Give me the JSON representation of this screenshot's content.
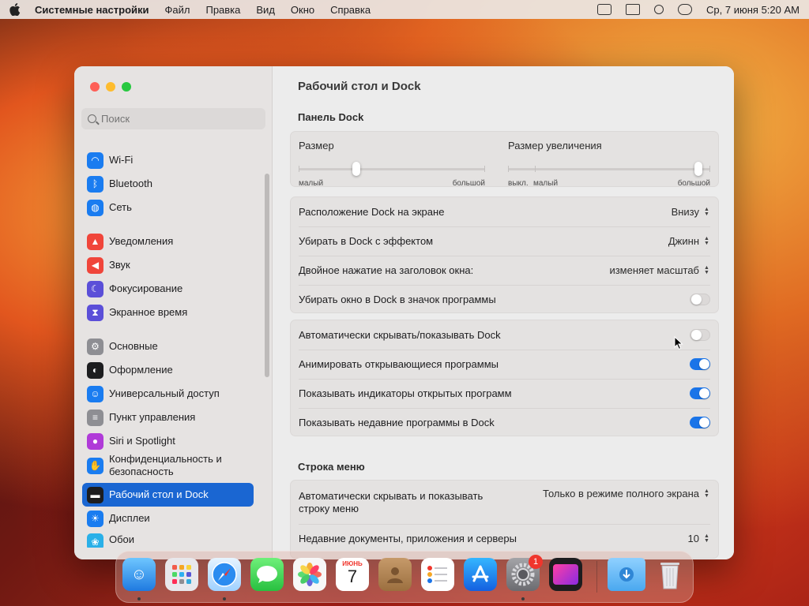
{
  "menubar": {
    "app": "Системные настройки",
    "items": [
      "Файл",
      "Правка",
      "Вид",
      "Окно",
      "Справка"
    ],
    "clock": "Ср, 7 июня  5:20 AM"
  },
  "sidebar": {
    "search_placeholder": "Поиск",
    "items": [
      {
        "label": "Wi-Fi",
        "icon": "wifi-icon",
        "color": "#1a7cf0"
      },
      {
        "label": "Bluetooth",
        "icon": "bluetooth-icon",
        "color": "#1a7cf0"
      },
      {
        "label": "Сеть",
        "icon": "globe-icon",
        "color": "#1a7cf0"
      },
      {
        "label": "Уведомления",
        "icon": "bell-icon",
        "color": "#f0453a"
      },
      {
        "label": "Звук",
        "icon": "speaker-icon",
        "color": "#f0453a"
      },
      {
        "label": "Фокусирование",
        "icon": "moon-icon",
        "color": "#5b4fd8"
      },
      {
        "label": "Экранное время",
        "icon": "hourglass-icon",
        "color": "#5b4fd8"
      },
      {
        "label": "Основные",
        "icon": "gear-icon",
        "color": "#8e8e93"
      },
      {
        "label": "Оформление",
        "icon": "appearance-icon",
        "color": "#1d1d1f"
      },
      {
        "label": "Универсальный доступ",
        "icon": "accessibility-icon",
        "color": "#1a7cf0"
      },
      {
        "label": "Пункт управления",
        "icon": "control-center-icon",
        "color": "#8e8e93"
      },
      {
        "label": "Siri и Spotlight",
        "icon": "siri-icon",
        "color": "#b03ad8"
      },
      {
        "label": "Конфиденциальность и безопасность",
        "icon": "hand-icon",
        "color": "#1a7cf0"
      },
      {
        "label": "Рабочий стол и Dock",
        "icon": "dock-icon",
        "color": "#1d1d1f",
        "selected": true
      },
      {
        "label": "Дисплеи",
        "icon": "sun-icon",
        "color": "#1a7cf0"
      },
      {
        "label": "Обои",
        "icon": "wallpaper-icon",
        "color": "#2ab0e8"
      }
    ]
  },
  "content": {
    "title": "Рабочий стол и Dock",
    "dock_section": "Панель Dock",
    "size": {
      "label": "Размер",
      "min": "малый",
      "max": "большой",
      "value": 0.31
    },
    "magnify": {
      "label": "Размер увеличения",
      "off": "выкл.",
      "min": "малый",
      "max": "большой",
      "value": 0.94
    },
    "rows1": [
      {
        "label": "Расположение Dock на экране",
        "value": "Внизу"
      },
      {
        "label": "Убирать в Dock с эффектом",
        "value": "Джинн"
      },
      {
        "label": "Двойное нажатие на заголовок окна:",
        "value": "изменяет масштаб"
      },
      {
        "label": "Убирать окно в Dock в значок программы",
        "toggle": false
      }
    ],
    "rows2": [
      {
        "label": "Автоматически скрывать/показывать Dock",
        "toggle": false
      },
      {
        "label": "Анимировать открывающиеся программы",
        "toggle": true
      },
      {
        "label": "Показывать индикаторы открытых программ",
        "toggle": true
      },
      {
        "label": "Показывать недавние программы в Dock",
        "toggle": true
      }
    ],
    "menu_section": "Строка меню",
    "rows3": [
      {
        "label": "Автоматически скрывать и показывать строку меню",
        "value": "Только в режиме полного экрана"
      },
      {
        "label": "Недавние документы, приложения и серверы",
        "value": "10"
      }
    ]
  },
  "dock": {
    "calendar_month": "ИЮНЬ",
    "calendar_day": "7",
    "settings_badge": "1"
  }
}
